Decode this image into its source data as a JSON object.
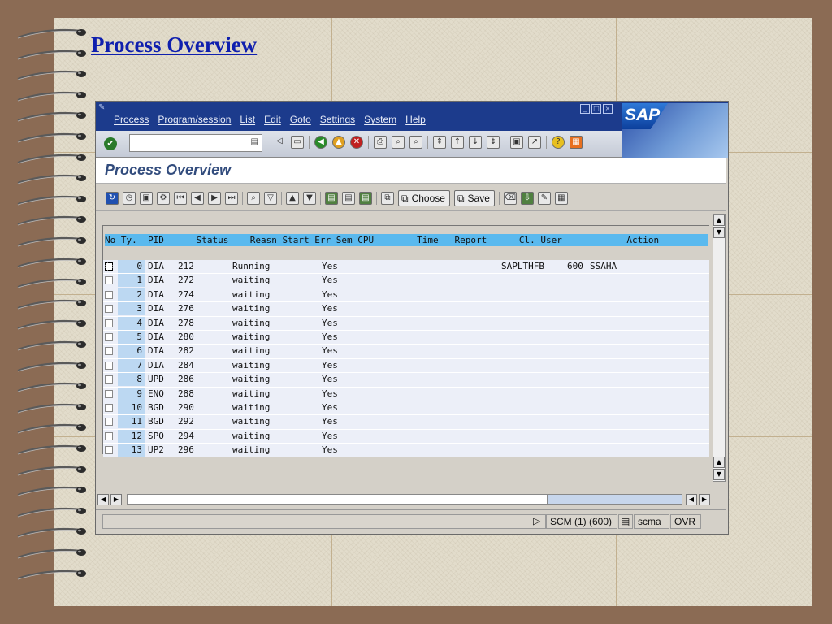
{
  "slide": {
    "title": "Process Overview"
  },
  "sap": {
    "menu": [
      "Process",
      "Program/session",
      "List",
      "Edit",
      "Goto",
      "Settings",
      "System",
      "Help"
    ],
    "logo_text": "SAP",
    "page_title": "Process Overview",
    "toolbar_buttons": {
      "choose": "Choose",
      "save": "Save"
    },
    "table": {
      "header": "No Ty.  PID      Status    Reasn Start Err Sem CPU        Time   Report      Cl. User            Action",
      "rows": [
        {
          "no": "0",
          "ty": "DIA",
          "pid": "212",
          "status": "Running",
          "start": "Yes",
          "report": "SAPLTHFB",
          "cl": "600",
          "user": "SSAHA"
        },
        {
          "no": "1",
          "ty": "DIA",
          "pid": "272",
          "status": "waiting",
          "start": "Yes",
          "report": "",
          "cl": "",
          "user": ""
        },
        {
          "no": "2",
          "ty": "DIA",
          "pid": "274",
          "status": "waiting",
          "start": "Yes",
          "report": "",
          "cl": "",
          "user": ""
        },
        {
          "no": "3",
          "ty": "DIA",
          "pid": "276",
          "status": "waiting",
          "start": "Yes",
          "report": "",
          "cl": "",
          "user": ""
        },
        {
          "no": "4",
          "ty": "DIA",
          "pid": "278",
          "status": "waiting",
          "start": "Yes",
          "report": "",
          "cl": "",
          "user": ""
        },
        {
          "no": "5",
          "ty": "DIA",
          "pid": "280",
          "status": "waiting",
          "start": "Yes",
          "report": "",
          "cl": "",
          "user": ""
        },
        {
          "no": "6",
          "ty": "DIA",
          "pid": "282",
          "status": "waiting",
          "start": "Yes",
          "report": "",
          "cl": "",
          "user": ""
        },
        {
          "no": "7",
          "ty": "DIA",
          "pid": "284",
          "status": "waiting",
          "start": "Yes",
          "report": "",
          "cl": "",
          "user": ""
        },
        {
          "no": "8",
          "ty": "UPD",
          "pid": "286",
          "status": "waiting",
          "start": "Yes",
          "report": "",
          "cl": "",
          "user": ""
        },
        {
          "no": "9",
          "ty": "ENQ",
          "pid": "288",
          "status": "waiting",
          "start": "Yes",
          "report": "",
          "cl": "",
          "user": ""
        },
        {
          "no": "10",
          "ty": "BGD",
          "pid": "290",
          "status": "waiting",
          "start": "Yes",
          "report": "",
          "cl": "",
          "user": ""
        },
        {
          "no": "11",
          "ty": "BGD",
          "pid": "292",
          "status": "waiting",
          "start": "Yes",
          "report": "",
          "cl": "",
          "user": ""
        },
        {
          "no": "12",
          "ty": "SPO",
          "pid": "294",
          "status": "waiting",
          "start": "Yes",
          "report": "",
          "cl": "",
          "user": ""
        },
        {
          "no": "13",
          "ty": "UP2",
          "pid": "296",
          "status": "waiting",
          "start": "Yes",
          "report": "",
          "cl": "",
          "user": ""
        }
      ]
    },
    "status": {
      "system": "SCM (1) (600)",
      "server": "scma",
      "mode": "OVR"
    }
  },
  "colors": {
    "menubar": "#1c3b8c",
    "header_row": "#5ab9ee",
    "title": "#0f1fae"
  }
}
